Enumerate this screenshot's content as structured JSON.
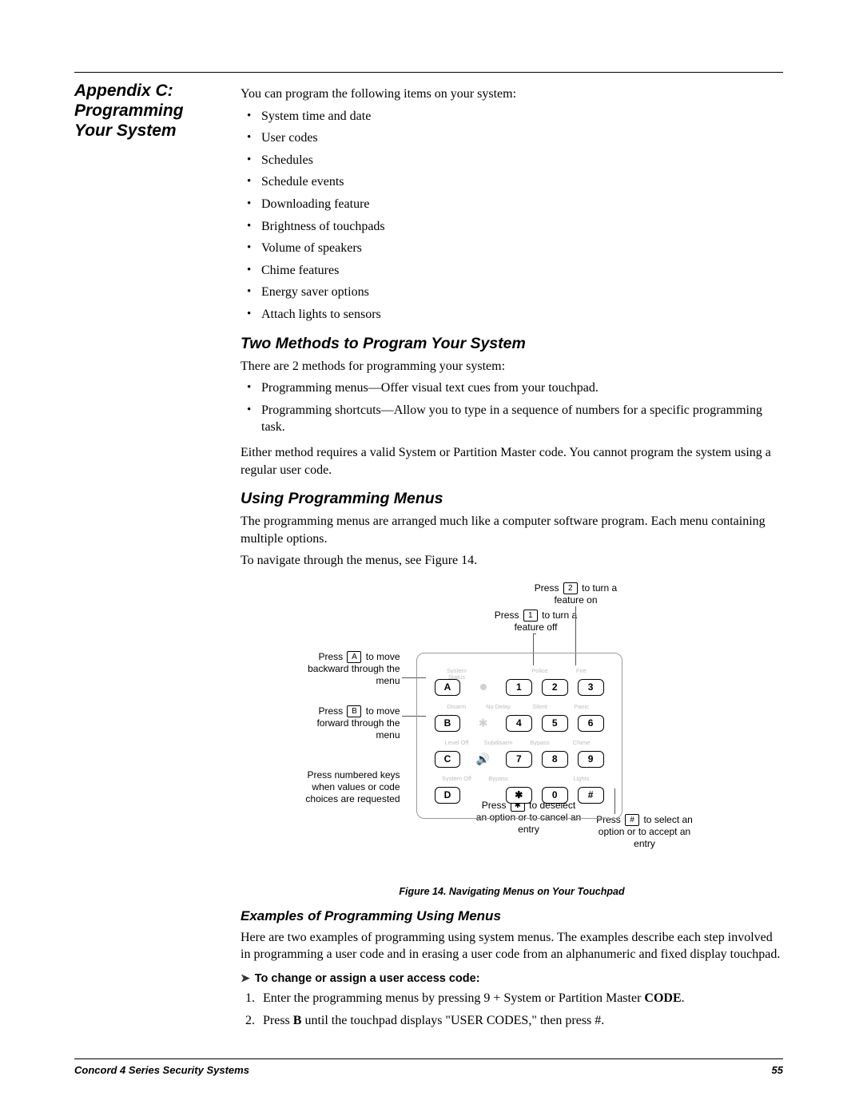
{
  "side_title": "Appendix C: Programming Your System",
  "intro": "You can program the following items on your system:",
  "items": [
    "System time and date",
    "User codes",
    "Schedules",
    "Schedule events",
    "Downloading feature",
    "Brightness of touchpads",
    "Volume of speakers",
    "Chime features",
    "Energy saver options",
    "Attach lights to sensors"
  ],
  "sec1": {
    "title": "Two Methods to Program Your System",
    "p1": "There are 2 methods for programming your system:",
    "bullets": [
      "Programming menus—Offer visual text cues from your touchpad.",
      "Programming shortcuts—Allow you to type in a sequence of numbers for a specific programming task."
    ],
    "p2": "Either method requires a valid System or Partition Master code. You cannot program the system using a regular user code."
  },
  "sec2": {
    "title": "Using Programming Menus",
    "p1": "The programming menus are arranged much like a computer software program. Each menu containing multiple options.",
    "p2": "To navigate through the menus, see Figure 14."
  },
  "figure": {
    "caption": "Figure 14. Navigating Menus on Your Touchpad",
    "ann_top2": {
      "pre": "Press ",
      "key": "2",
      "post": " to turn a feature on"
    },
    "ann_top1": {
      "pre": "Press ",
      "key": "1",
      "post": " to turn a feature off"
    },
    "ann_a": {
      "pre": "Press ",
      "key": "A",
      "post": " to move backward through the menu"
    },
    "ann_b": {
      "pre": "Press ",
      "key": "B",
      "post": " to move forward through the menu"
    },
    "ann_num": "Press numbered keys when values or code choices are requested",
    "ann_star": {
      "pre": "Press ",
      "key": "✱",
      "post": " to deselect an option or to cancel an entry"
    },
    "ann_hash": {
      "pre": "Press ",
      "key": "#",
      "post": " to select an option or to accept an entry"
    },
    "key_labels": {
      "r1": [
        "System Status",
        "",
        "Police",
        "Fire"
      ],
      "r2": [
        "Disarm",
        "No Delay",
        "Silent",
        "Panic"
      ],
      "r3": [
        "Level Off",
        "Subdisarm",
        "Bypass",
        "Chime"
      ],
      "r4": [
        "System Off",
        "Bypass",
        "",
        "Lights"
      ]
    },
    "keys": {
      "r1": [
        "A",
        "",
        "1",
        "2",
        "3"
      ],
      "r2": [
        "B",
        "",
        "4",
        "5",
        "6"
      ],
      "r3": [
        "C",
        "",
        "7",
        "8",
        "9"
      ],
      "r4": [
        "D",
        "",
        "✱",
        "0",
        "#"
      ]
    }
  },
  "sec3": {
    "title": "Examples of Programming Using Menus",
    "p1": "Here are two examples of programming using system menus. The examples describe each step involved in programming a user code and in erasing a user code from an alphanumeric and fixed display touchpad.",
    "task_title": "To change or assign a user access code:",
    "steps": [
      {
        "pre": "Enter the programming menus by pressing ",
        "mid": "9",
        "post": " + System or Partition Master ",
        "tail": "CODE",
        "end": "."
      },
      {
        "pre": "Press ",
        "mid": "B",
        "post": " until the touchpad displays \"USER CODES,\" then press ",
        "tail": "#",
        "end": "."
      }
    ]
  },
  "footer": {
    "title": "Concord 4 Series Security Systems",
    "page": "55"
  }
}
